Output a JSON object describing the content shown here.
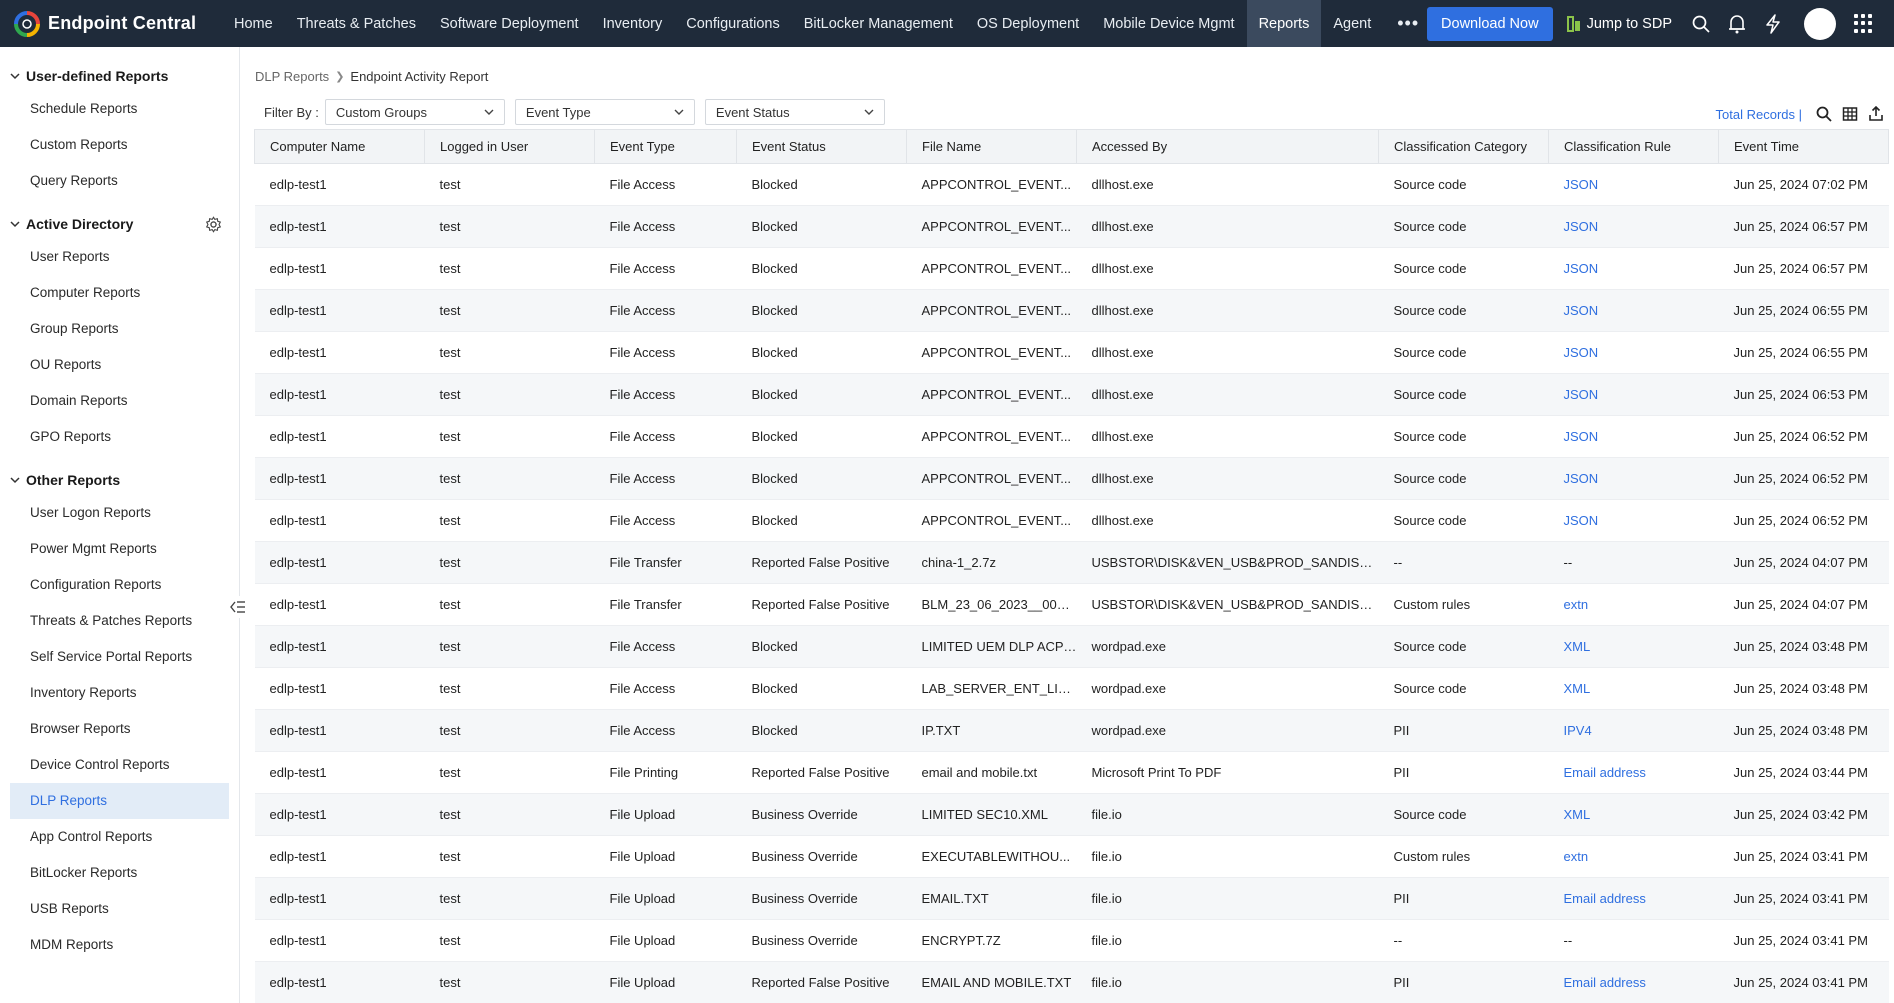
{
  "app": {
    "name": "Endpoint Central"
  },
  "nav": {
    "items": [
      "Home",
      "Threats & Patches",
      "Software Deployment",
      "Inventory",
      "Configurations",
      "BitLocker Management",
      "OS Deployment",
      "Mobile Device Mgmt",
      "Reports",
      "Agent"
    ],
    "active": "Reports",
    "more": "•••",
    "download_label": "Download Now",
    "jump_label": "Jump to SDP"
  },
  "sidebar": {
    "sections": [
      {
        "title": "User-defined Reports",
        "items": [
          "Schedule Reports",
          "Custom Reports",
          "Query Reports"
        ]
      },
      {
        "title": "Active Directory",
        "items": [
          "User Reports",
          "Computer Reports",
          "Group Reports",
          "OU Reports",
          "Domain Reports",
          "GPO Reports"
        ]
      },
      {
        "title": "Other Reports",
        "items": [
          "User Logon Reports",
          "Power Mgmt Reports",
          "Configuration Reports",
          "Threats & Patches Reports",
          "Self Service Portal Reports",
          "Inventory Reports",
          "Browser Reports",
          "Device Control Reports",
          "DLP Reports",
          "App Control Reports",
          "BitLocker Reports",
          "USB Reports",
          "MDM Reports"
        ]
      }
    ],
    "active_item": "DLP Reports"
  },
  "breadcrumb": {
    "parent": "DLP Reports",
    "current": "Endpoint Activity Report"
  },
  "filters": {
    "label": "Filter By :",
    "custom_groups": "Custom Groups",
    "event_type": "Event Type",
    "event_status": "Event Status"
  },
  "table_tools": {
    "total_records": "Total Records |"
  },
  "table": {
    "columns": [
      "Computer Name",
      "Logged in User",
      "Event Type",
      "Event Status",
      "File Name",
      "Accessed By",
      "Classification Category",
      "Classification Rule",
      "Event Time"
    ],
    "rows": [
      [
        "edlp-test1",
        "test",
        "File Access",
        "Blocked",
        "APPCONTROL_EVENT...",
        "dllhost.exe",
        "Source code",
        "JSON",
        "Jun 25, 2024 07:02 PM"
      ],
      [
        "edlp-test1",
        "test",
        "File Access",
        "Blocked",
        "APPCONTROL_EVENT...",
        "dllhost.exe",
        "Source code",
        "JSON",
        "Jun 25, 2024 06:57 PM"
      ],
      [
        "edlp-test1",
        "test",
        "File Access",
        "Blocked",
        "APPCONTROL_EVENT...",
        "dllhost.exe",
        "Source code",
        "JSON",
        "Jun 25, 2024 06:57 PM"
      ],
      [
        "edlp-test1",
        "test",
        "File Access",
        "Blocked",
        "APPCONTROL_EVENT...",
        "dllhost.exe",
        "Source code",
        "JSON",
        "Jun 25, 2024 06:55 PM"
      ],
      [
        "edlp-test1",
        "test",
        "File Access",
        "Blocked",
        "APPCONTROL_EVENT...",
        "dllhost.exe",
        "Source code",
        "JSON",
        "Jun 25, 2024 06:55 PM"
      ],
      [
        "edlp-test1",
        "test",
        "File Access",
        "Blocked",
        "APPCONTROL_EVENT...",
        "dllhost.exe",
        "Source code",
        "JSON",
        "Jun 25, 2024 06:53 PM"
      ],
      [
        "edlp-test1",
        "test",
        "File Access",
        "Blocked",
        "APPCONTROL_EVENT...",
        "dllhost.exe",
        "Source code",
        "JSON",
        "Jun 25, 2024 06:52 PM"
      ],
      [
        "edlp-test1",
        "test",
        "File Access",
        "Blocked",
        "APPCONTROL_EVENT...",
        "dllhost.exe",
        "Source code",
        "JSON",
        "Jun 25, 2024 06:52 PM"
      ],
      [
        "edlp-test1",
        "test",
        "File Access",
        "Blocked",
        "APPCONTROL_EVENT...",
        "dllhost.exe",
        "Source code",
        "JSON",
        "Jun 25, 2024 06:52 PM"
      ],
      [
        "edlp-test1",
        "test",
        "File Transfer",
        "Reported False Positive",
        "china-1_2.7z",
        "USBSTOR\\DISK&VEN_USB&PROD_SANDISK...",
        "--",
        "--",
        "Jun 25, 2024 04:07 PM"
      ],
      [
        "edlp-test1",
        "test",
        "File Transfer",
        "Reported False Positive",
        "BLM_23_06_2023__00_5...",
        "USBSTOR\\DISK&VEN_USB&PROD_SANDISK...",
        "Custom rules",
        "extn",
        "Jun 25, 2024 04:07 PM"
      ],
      [
        "edlp-test1",
        "test",
        "File Access",
        "Blocked",
        "LIMITED UEM DLP ACP ...",
        "wordpad.exe",
        "Source code",
        "XML",
        "Jun 25, 2024 03:48 PM"
      ],
      [
        "edlp-test1",
        "test",
        "File Access",
        "Blocked",
        "LAB_SERVER_ENT_LIC....",
        "wordpad.exe",
        "Source code",
        "XML",
        "Jun 25, 2024 03:48 PM"
      ],
      [
        "edlp-test1",
        "test",
        "File Access",
        "Blocked",
        "IP.TXT",
        "wordpad.exe",
        "PII",
        "IPV4",
        "Jun 25, 2024 03:48 PM"
      ],
      [
        "edlp-test1",
        "test",
        "File Printing",
        "Reported False Positive",
        "email and mobile.txt",
        "Microsoft Print To PDF",
        "PII",
        "Email address",
        "Jun 25, 2024 03:44 PM"
      ],
      [
        "edlp-test1",
        "test",
        "File Upload",
        "Business Override",
        "LIMITED SEC10.XML",
        "file.io",
        "Source code",
        "XML",
        "Jun 25, 2024 03:42 PM"
      ],
      [
        "edlp-test1",
        "test",
        "File Upload",
        "Business Override",
        "EXECUTABLEWITHOU...",
        "file.io",
        "Custom rules",
        "extn",
        "Jun 25, 2024 03:41 PM"
      ],
      [
        "edlp-test1",
        "test",
        "File Upload",
        "Business Override",
        "EMAIL.TXT",
        "file.io",
        "PII",
        "Email address",
        "Jun 25, 2024 03:41 PM"
      ],
      [
        "edlp-test1",
        "test",
        "File Upload",
        "Business Override",
        "ENCRYPT.7Z",
        "file.io",
        "--",
        "--",
        "Jun 25, 2024 03:41 PM"
      ],
      [
        "edlp-test1",
        "test",
        "File Upload",
        "Reported False Positive",
        "EMAIL AND MOBILE.TXT",
        "file.io",
        "PII",
        "Email address",
        "Jun 25, 2024 03:41 PM"
      ]
    ]
  },
  "colors": {
    "topbar": "#1f2b3a",
    "accent": "#2f6fe0",
    "active_nav": "#3b4a5e"
  }
}
